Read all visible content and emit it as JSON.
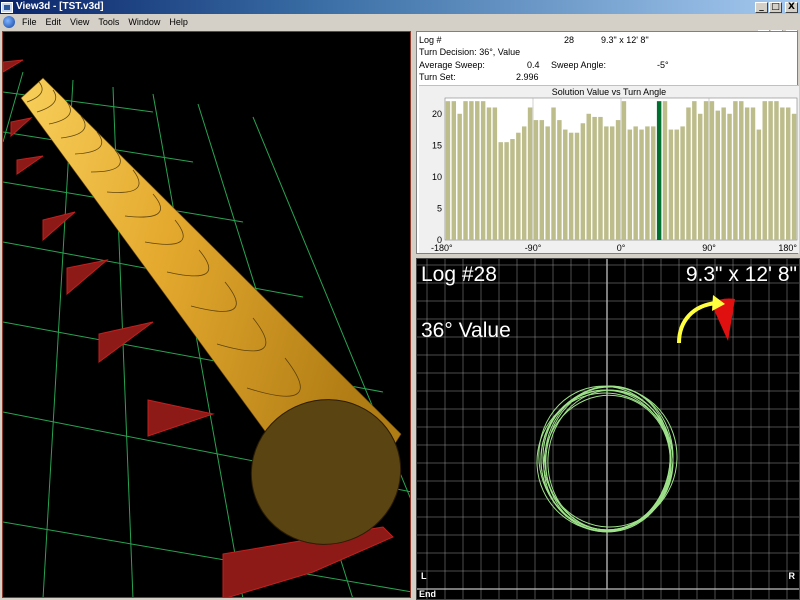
{
  "window": {
    "title": "View3d - [TST.v3d]",
    "minimize_glyph": "_",
    "maximize_glyph": "□",
    "close_glyph": "X",
    "restore_glyph": "▫"
  },
  "menu": {
    "items": [
      "File",
      "Edit",
      "View",
      "Tools",
      "Window",
      "Help"
    ]
  },
  "info": {
    "log_label": "Log #",
    "log_value": "28",
    "log_size": "9.3\" x 12' 8\"",
    "turn_decision": "Turn Decision: 36°, Value",
    "avg_sweep_label": "Average Sweep:",
    "avg_sweep_value": "0.4",
    "sweep_angle_label": "Sweep Angle:",
    "sweep_angle_value": "-5°",
    "turn_set_label": "Turn Set:",
    "turn_set_value": "2.996"
  },
  "chart_data": {
    "type": "bar",
    "title": "Solution Value vs Turn Angle",
    "xlabel": "",
    "ylabel": "",
    "xlim": [
      -180,
      180
    ],
    "ylim": [
      0,
      22.5
    ],
    "xticks": [
      "-180°",
      "-90°",
      "0°",
      "90°",
      "180°"
    ],
    "yticks": [
      "0",
      "5",
      "10",
      "15",
      "20"
    ],
    "bar_color": "#bdbd8c",
    "highlight_color": "#007030",
    "highlight_angle": 36,
    "x": [
      -180,
      -174,
      -168,
      -162,
      -156,
      -150,
      -144,
      -138,
      -132,
      -126,
      -120,
      -114,
      -108,
      -102,
      -96,
      -90,
      -84,
      -78,
      -72,
      -66,
      -60,
      -54,
      -48,
      -42,
      -36,
      -30,
      -24,
      -18,
      -12,
      -6,
      0,
      6,
      12,
      18,
      24,
      30,
      36,
      42,
      48,
      54,
      60,
      66,
      72,
      78,
      84,
      90,
      96,
      102,
      108,
      114,
      120,
      126,
      132,
      138,
      144,
      150,
      156,
      162,
      168,
      174
    ],
    "values": [
      22,
      22,
      20,
      22,
      22,
      22,
      22,
      21,
      21,
      15.5,
      15.5,
      16,
      17,
      18,
      21,
      19,
      19,
      18,
      21,
      19,
      17.5,
      17,
      17,
      18.5,
      20,
      19.5,
      19.5,
      18,
      18,
      19,
      22,
      17.5,
      18,
      17.5,
      18,
      18,
      22,
      22,
      17.5,
      17.5,
      18,
      21,
      22,
      20,
      22,
      22,
      20.5,
      21,
      20,
      22,
      22,
      21,
      21,
      17.5,
      22,
      22,
      22,
      21,
      21,
      20
    ]
  },
  "cross_section": {
    "log_label": "Log #28",
    "size_label": "9.3\" x 12' 8\"",
    "decision_label": "36° Value",
    "corner_left": "L",
    "corner_right": "R",
    "corner_end": "End",
    "grid_color": "#9a9a9a",
    "outline_color": "#9ee28a",
    "arrow_color": "#ffff40",
    "indicator_color": "#e01010"
  },
  "scene3d": {
    "log_color": "#e4a92e",
    "end_color": "#5a4412",
    "grid_color": "#30c060",
    "support_color": "#c0201e"
  }
}
